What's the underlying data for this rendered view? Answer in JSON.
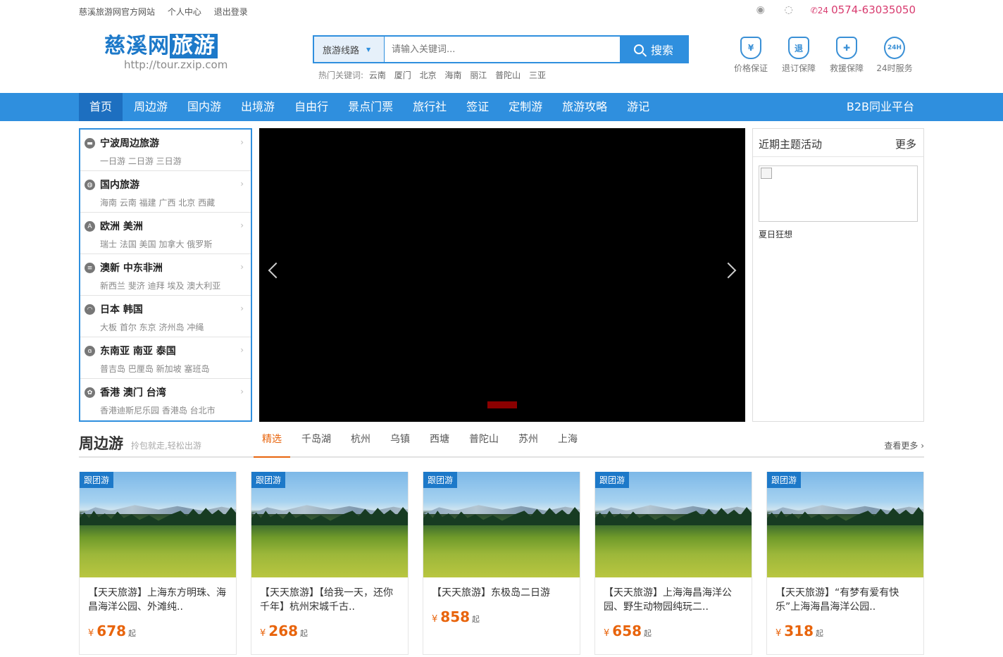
{
  "topbar": {
    "site_name": "慈溪旅游网官方网站",
    "user_center": "个人中心",
    "logout": "退出登录",
    "phone": "0574-63035050",
    "phone_badge": "24"
  },
  "header": {
    "logo_main": "慈溪网",
    "logo_highlight": "旅游",
    "logo_url": "http://tour.zxip.com",
    "search_type": "旅游线路",
    "search_placeholder": "请输入关键词...",
    "search_button": "搜索",
    "hot_label": "热门关键词:",
    "hot_keywords": [
      "云南",
      "厦门",
      "北京",
      "海南",
      "丽江",
      "普陀山",
      "三亚"
    ],
    "guarantees": [
      {
        "icon": "yen-shield-icon",
        "glyph": "¥",
        "label": "价格保证"
      },
      {
        "icon": "refund-shield-icon",
        "glyph": "退",
        "label": "退订保障"
      },
      {
        "icon": "rescue-kit-icon",
        "glyph": "✚",
        "label": "救援保障"
      },
      {
        "icon": "24h-service-icon",
        "glyph": "24H",
        "label": "24时服务"
      }
    ]
  },
  "nav": {
    "items": [
      "首页",
      "周边游",
      "国内游",
      "出境游",
      "自由行",
      "景点门票",
      "旅行社",
      "签证",
      "定制游",
      "旅游攻略",
      "游记"
    ],
    "b2b": "B2B同业平台"
  },
  "categories": [
    {
      "title": "宁波周边旅游",
      "sub": "一日游 二日游 三日游"
    },
    {
      "title": "国内旅游",
      "sub": "海南 云南 福建 广西 北京 西藏"
    },
    {
      "title": "欧洲 美洲",
      "sub": "瑞士 法国 美国 加拿大 俄罗斯"
    },
    {
      "title": "澳新 中东非洲",
      "sub": "新西兰 斐济 迪拜 埃及 澳大利亚"
    },
    {
      "title": "日本 韩国",
      "sub": "大板 首尔 东京 济州岛 冲绳"
    },
    {
      "title": "东南亚 南亚 泰国",
      "sub": "普吉岛 巴厘岛 新加坡 塞班岛"
    },
    {
      "title": "香港 澳门 台湾",
      "sub": "香港迪斯尼乐园 香港岛 台北市"
    }
  ],
  "events": {
    "title": "近期主题活动",
    "more": "更多",
    "caption": "夏日狂想"
  },
  "section": {
    "title": "周边游",
    "subtitle": "拎包就走,轻松出游",
    "tabs": [
      "精选",
      "千岛湖",
      "杭州",
      "乌镇",
      "西塘",
      "普陀山",
      "苏州",
      "上海"
    ],
    "more": "查看更多"
  },
  "cards": [
    {
      "tag": "跟团游",
      "title": "【天天旅游】上海东方明珠、海昌海洋公园、外滩纯..",
      "currency": "¥",
      "price": "678",
      "suffix": "起"
    },
    {
      "tag": "跟团游",
      "title": "【天天旅游】【给我一天，还你千年】杭州宋城千古..",
      "currency": "¥",
      "price": "268",
      "suffix": "起"
    },
    {
      "tag": "跟团游",
      "title": "【天天旅游】东极岛二日游",
      "currency": "¥",
      "price": "858",
      "suffix": "起"
    },
    {
      "tag": "跟团游",
      "title": "【天天旅游】上海海昌海洋公园、野生动物园纯玩二..",
      "currency": "¥",
      "price": "658",
      "suffix": "起"
    },
    {
      "tag": "跟团游",
      "title": "【天天旅游】“有梦有爱有快乐”上海海昌海洋公园..",
      "currency": "¥",
      "price": "318",
      "suffix": "起"
    }
  ],
  "colors": {
    "brand": "#2f8fde",
    "accent": "#e8640c",
    "phone": "#d83b6f"
  }
}
